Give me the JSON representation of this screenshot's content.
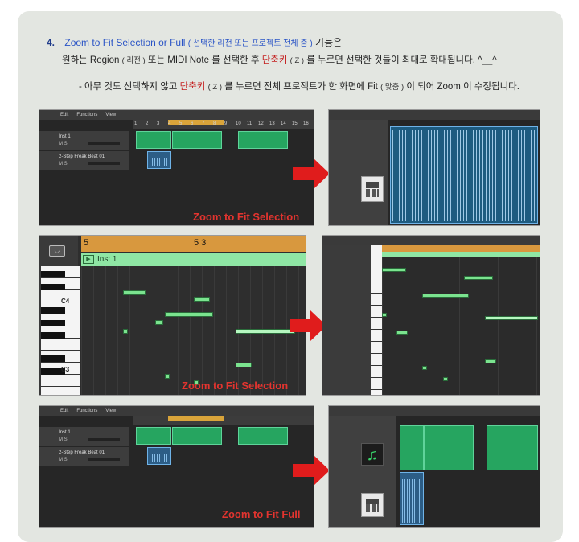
{
  "heading": {
    "number": "4.",
    "title": "Zoom to Fit Selection or Full",
    "title_kr": "( 선택한 리전 또는 프로젝트 전체 줌 )",
    "suffix": "기능은"
  },
  "line2": {
    "part1": "원하는 Region",
    "part1_small": "( 리전 )",
    "part2": "또는 MIDI Note 를 선택한 후",
    "shortcut": "단축키",
    "key": "( Z )",
    "part3": "를 누르면 선택한 것들이 최대로 확대됩니다. ^__^"
  },
  "line3": {
    "part1": "- 아무 것도 선택하지 않고",
    "shortcut": "단축키",
    "key": "( Z )",
    "part2": "를 누르면 전체 프로젝트가 한 화면에 Fit",
    "fit_small": "( 맞춤 )",
    "part3": "이 되어 Zoom 이 수정됩니다."
  },
  "captions": {
    "c1": "Zoom to Fit Selection",
    "c2": "Zoom to Fit Selection",
    "c3": "Zoom to Fit Full"
  },
  "daw": {
    "menu": [
      "Edit",
      "Functions",
      "View"
    ],
    "ruler_ticks": [
      "1",
      "2",
      "3",
      "4",
      "5",
      "6",
      "7",
      "8",
      "9",
      "10",
      "11",
      "12",
      "13",
      "14",
      "15",
      "16"
    ],
    "track1": "Inst 1",
    "track2": "2-Step Freak Beat 01",
    "ms": "M S",
    "region_label": "Inst 1",
    "audio_label": "2-Step Freak"
  },
  "piano": {
    "bar_a": "5",
    "bar_b": "5 3",
    "region": "Inst 1",
    "c4": "C4",
    "c3": "C3"
  },
  "colors": {
    "accent_blue": "#2a54c6",
    "accent_red": "#c42020",
    "caption_red": "#e3342f",
    "region_green": "#26a560",
    "audio_blue": "#2c5d86"
  }
}
